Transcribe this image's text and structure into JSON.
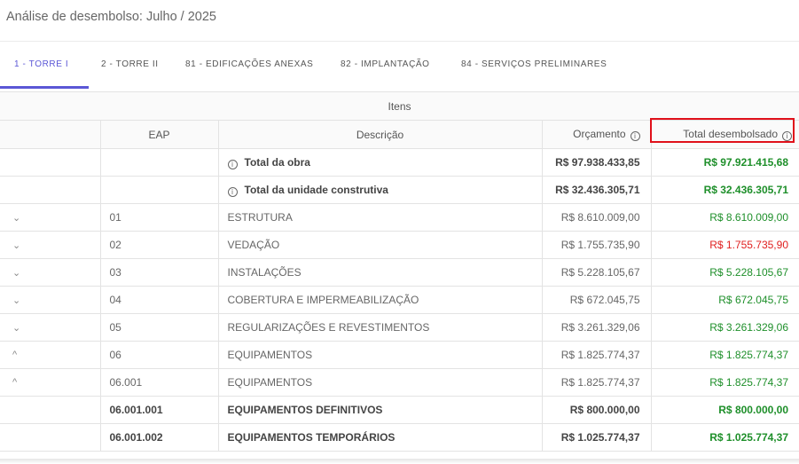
{
  "page_title": "Análise de desembolso: Julho / 2025",
  "tabs": [
    {
      "label": "1 - TORRE I",
      "active": true
    },
    {
      "label": "2 - TORRE II",
      "active": false
    },
    {
      "label": "81 - EDIFICAÇÕES ANEXAS",
      "active": false
    },
    {
      "label": "82 - IMPLANTAÇÃO",
      "active": false
    },
    {
      "label": "84 - SERVIÇOS PRELIMINARES",
      "active": false
    }
  ],
  "table": {
    "group_header": "Itens",
    "columns": {
      "eap": "EAP",
      "descricao": "Descrição",
      "orcamento": "Orçamento",
      "total": "Total desembolsado"
    },
    "summary_rows": [
      {
        "descricao": "Total da obra",
        "orcamento": "R$ 97.938.433,85",
        "total": "R$ 97.921.415,68"
      },
      {
        "descricao": "Total da unidade construtiva",
        "orcamento": "R$ 32.436.305,71",
        "total": "R$ 32.436.305,71"
      }
    ],
    "rows": [
      {
        "toggle": "⌄",
        "eap": "01",
        "descricao": "ESTRUTURA",
        "orcamento": "R$ 8.610.009,00",
        "total": "R$ 8.610.009,00",
        "status": "green"
      },
      {
        "toggle": "⌄",
        "eap": "02",
        "descricao": "VEDAÇÃO",
        "orcamento": "R$ 1.755.735,90",
        "total": "R$ 1.755.735,90",
        "status": "red"
      },
      {
        "toggle": "⌄",
        "eap": "03",
        "descricao": "INSTALAÇÕES",
        "orcamento": "R$ 5.228.105,67",
        "total": "R$ 5.228.105,67",
        "status": "green"
      },
      {
        "toggle": "⌄",
        "eap": "04",
        "descricao": "COBERTURA E IMPERMEABILIZAÇÃO",
        "orcamento": "R$ 672.045,75",
        "total": "R$ 672.045,75",
        "status": "green"
      },
      {
        "toggle": "⌄",
        "eap": "05",
        "descricao": "REGULARIZAÇÕES E REVESTIMENTOS",
        "orcamento": "R$ 3.261.329,06",
        "total": "R$ 3.261.329,06",
        "status": "green"
      },
      {
        "toggle": "^",
        "eap": "06",
        "descricao": "EQUIPAMENTOS",
        "orcamento": "R$ 1.825.774,37",
        "total": "R$ 1.825.774,37",
        "status": "green"
      },
      {
        "toggle": "^",
        "eap": "06.001",
        "descricao": "EQUIPAMENTOS",
        "orcamento": "R$ 1.825.774,37",
        "total": "R$ 1.825.774,37",
        "status": "green"
      },
      {
        "toggle": "",
        "eap": "06.001.001",
        "descricao": "EQUIPAMENTOS DEFINITIVOS",
        "orcamento": "R$ 800.000,00",
        "total": "R$ 800.000,00",
        "status": "green",
        "bold": true
      },
      {
        "toggle": "",
        "eap": "06.001.002",
        "descricao": "EQUIPAMENTOS TEMPORÁRIOS",
        "orcamento": "R$ 1.025.774,37",
        "total": "R$ 1.025.774,37",
        "status": "green",
        "bold": true
      }
    ]
  },
  "colors": {
    "accent": "#5b57d6",
    "positive": "#1e8f2a",
    "negative": "#e02020",
    "highlight": "#e0101a"
  }
}
